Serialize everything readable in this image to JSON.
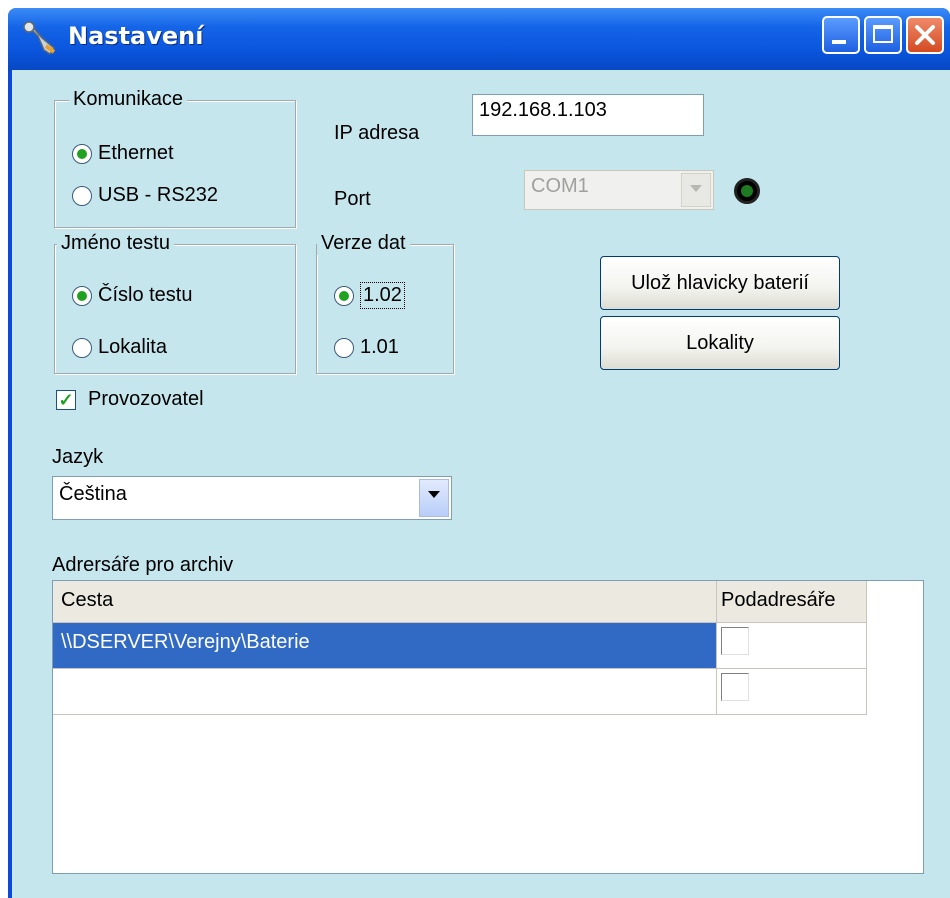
{
  "window": {
    "title": "Nastavení"
  },
  "komunikace": {
    "title": "Komunikace",
    "options": [
      {
        "label": "Ethernet",
        "checked": true
      },
      {
        "label": "USB - RS232",
        "checked": false
      }
    ]
  },
  "ip": {
    "label": "IP adresa",
    "value": "192.168.1.103"
  },
  "port": {
    "label": "Port",
    "value": "COM1"
  },
  "jmeno_testu": {
    "title": "Jméno testu",
    "options": [
      {
        "label": "Číslo testu",
        "checked": true
      },
      {
        "label": "Lokalita",
        "checked": false
      }
    ]
  },
  "verze_dat": {
    "title": "Verze dat",
    "options": [
      {
        "label": "1.02",
        "checked": true
      },
      {
        "label": "1.01",
        "checked": false
      }
    ]
  },
  "buttons": {
    "save_headers": "Ulož hlavicky baterií",
    "localities": "Lokality"
  },
  "provozovatel": {
    "label": "Provozovatel",
    "checked": true
  },
  "jazyk": {
    "label": "Jazyk",
    "value": "Čeština"
  },
  "archive": {
    "label": "Adrersáře pro archiv",
    "columns": [
      "Cesta",
      "Podadresáře"
    ],
    "rows": [
      {
        "path": "\\\\DSERVER\\Verejny\\Baterie",
        "sub": false,
        "selected": true
      },
      {
        "path": "",
        "sub": false,
        "selected": false
      }
    ]
  },
  "colors": {
    "title_bar": "#0a55dc",
    "client_bg": "#c6e6ed",
    "selection": "#316ac5",
    "radio_dot": "#21a121"
  }
}
